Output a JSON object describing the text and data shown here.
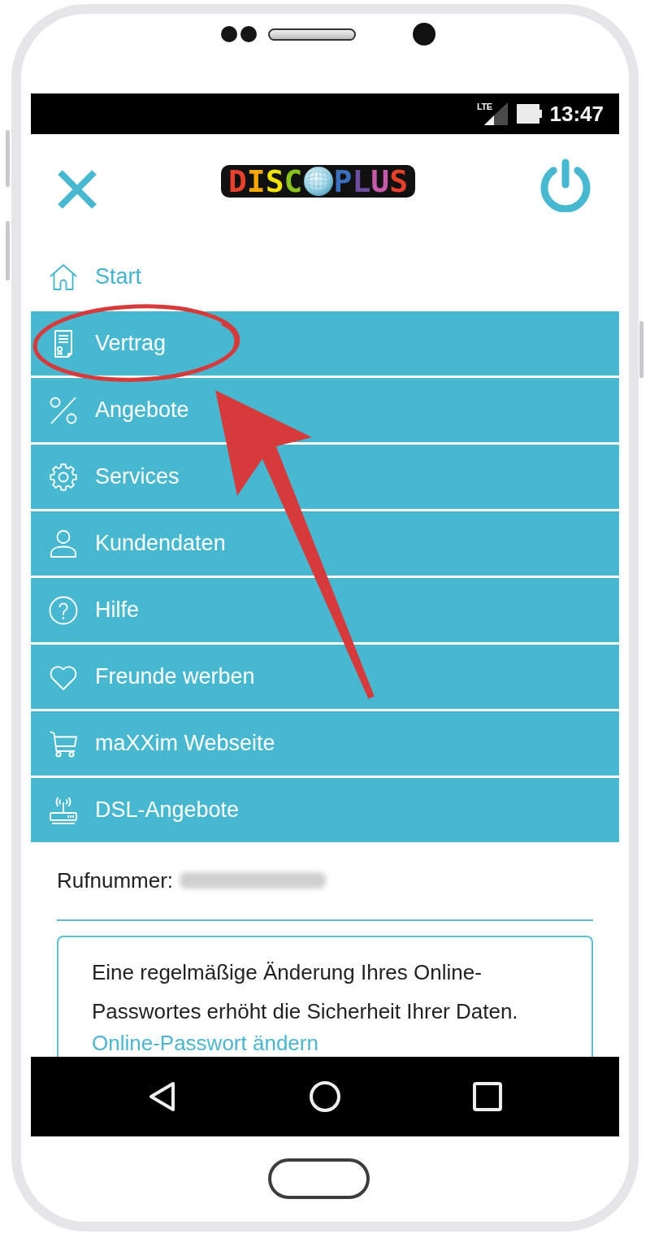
{
  "status_bar": {
    "network": "LTE",
    "time": "13:47"
  },
  "header": {
    "logo": {
      "before": "DISC",
      "after": "PLUS"
    }
  },
  "menu": [
    {
      "label": "Start",
      "selected": true,
      "annotated": false
    },
    {
      "label": "Vertrag",
      "selected": false,
      "annotated": true
    },
    {
      "label": "Angebote",
      "selected": false,
      "annotated": false
    },
    {
      "label": "Services",
      "selected": false,
      "annotated": false
    },
    {
      "label": "Kundendaten",
      "selected": false,
      "annotated": false
    },
    {
      "label": "Hilfe",
      "selected": false,
      "annotated": false
    },
    {
      "label": "Freunde werben",
      "selected": false,
      "annotated": false
    },
    {
      "label": "maXXim Webseite",
      "selected": false,
      "annotated": false
    },
    {
      "label": "DSL-Angebote",
      "selected": false,
      "annotated": false
    }
  ],
  "account": {
    "label": "Rufnummer:"
  },
  "notice": {
    "text": "Eine regelmäßige Änderung Ihres Online-Passwortes erhöht die Sicherheit Ihrer Daten.",
    "link": "Online-Passwort ändern"
  }
}
